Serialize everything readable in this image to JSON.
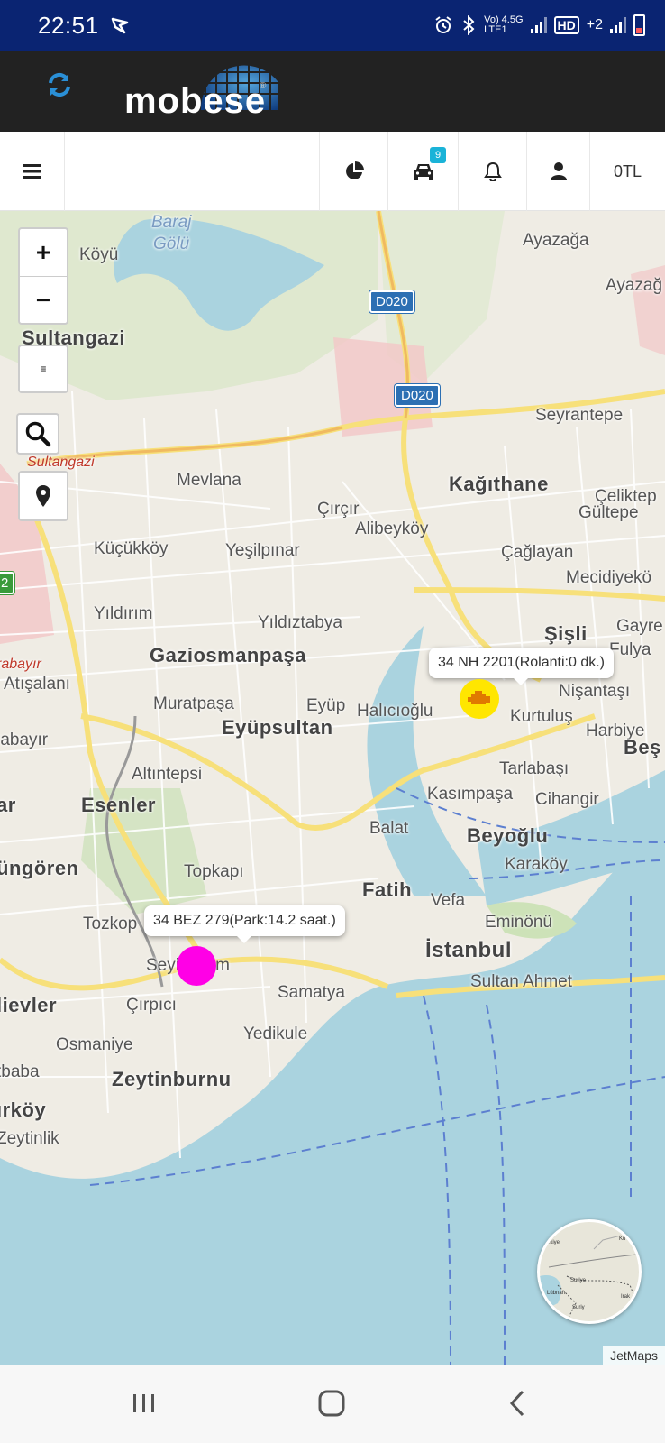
{
  "status_bar": {
    "time": "22:51",
    "net1": "Vo) 4.5G",
    "net2": "LTE1",
    "hd": "HD",
    "sim2": "+2"
  },
  "header": {
    "app_name": "mobese",
    "reg_mark": "®"
  },
  "toolbar": {
    "vehicle_badge": "9",
    "balance": "0TL"
  },
  "map": {
    "controls": {
      "zoom_in": "+",
      "zoom_out": "−",
      "layers": "≡"
    },
    "labels": {
      "baraj": "Baraj",
      "golu": "Gölü",
      "koyu": "Köyü",
      "ayazaga": "Ayazağa",
      "ayazag2": "Ayazağ",
      "sultangazi": "Sultangazi",
      "sultangazi_red": "Sultangazi",
      "seyrantepe": "Seyrantepe",
      "mevlana": "Mevlana",
      "kagithane": "Kağıthane",
      "celiktepe": "Çeliktep",
      "gultepe": "Gültepe",
      "circir": "Çırçır",
      "alibeykoy": "Alibeyköy",
      "kucukkoy": "Küçükköy",
      "yesilpinar": "Yeşilpınar",
      "caglayan": "Çağlayan",
      "mecidiyekoy": "Mecidiyekö",
      "yildirim": "Yıldırım",
      "yildiztabya": "Yıldıztabya",
      "sisli": "Şişli",
      "gayre": "Gayre",
      "fulya": "Fulya",
      "bayir": "rabayır",
      "gaziosmanpasa": "Gaziosmanpaşa",
      "atisalani": "Atışalanı",
      "nisantasi": "Nişantaşı",
      "muratpasa": "Muratpaşa",
      "eyup": "Eyüp",
      "halicioglu": "Halıcıoğlu",
      "kurtulus": "Kurtuluş",
      "eyupsultan": "Eyüpsultan",
      "harbiye": "Harbiye",
      "bes": "Beş",
      "bayir2": "rabayır",
      "altintepsi": "Altıntepsi",
      "tarlabasi": "Tarlabaşı",
      "esenler": "Esenler",
      "kasimpasa": "Kasımpaşa",
      "cihangir": "Cihangir",
      "ar": "ar",
      "balat": "Balat",
      "beyoglu": "Beyoğlu",
      "gungoren": "üngören",
      "topkapi": "Topkapı",
      "karakoy": "Karaköy",
      "fatih": "Fatih",
      "vefa": "Vefa",
      "tozkop": "Tozkop",
      "eminonu": "Eminönü",
      "istanbul": "İstanbul",
      "seyitnizam": "Seyitnizam",
      "samatya": "Samatya",
      "sultanahmet": "Sultan Ahmet",
      "lievler": "lievler",
      "cirpici": "Çırpıcı",
      "yedikule": "Yedikule",
      "osmaniye": "Osmaniye",
      "tbaba": "tbaba",
      "zeytinburnu": "Zeytinburnu",
      "kirkoy": "ırköy",
      "zeytinlik": "Zeytinlik"
    },
    "road_shields": [
      "D020",
      "D020",
      "2"
    ],
    "markers": [
      {
        "label": "34 NH 2201(Rolanti:0 dk.)",
        "color": "#ffe600",
        "status": "idle"
      },
      {
        "label": "34 BEZ 279(Park:14.2 saat.)",
        "color": "#ff00e6",
        "status": "parked"
      }
    ],
    "minimap_labels": [
      "ürkiye",
      "Suriye",
      "Lübnan",
      "Irak",
      "Suriy",
      "Ku"
    ],
    "attribution": "JetMaps"
  },
  "colors": {
    "status_bar": "#0a2472",
    "header": "#222222",
    "accent": "#1ab3d8",
    "water": "#aad3df",
    "road": "#f7e07a"
  }
}
